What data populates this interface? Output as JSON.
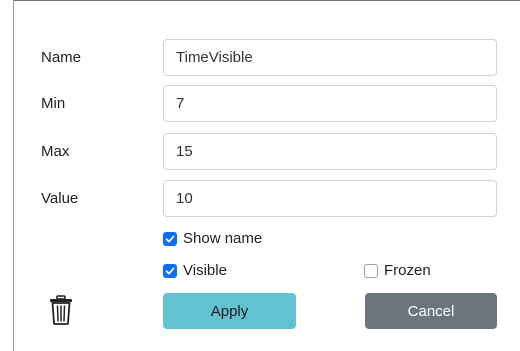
{
  "form": {
    "name": {
      "label": "Name",
      "value": "TimeVisible"
    },
    "min": {
      "label": "Min",
      "value": "7"
    },
    "max": {
      "label": "Max",
      "value": "15"
    },
    "value": {
      "label": "Value",
      "value": "10"
    }
  },
  "options": {
    "show_name": {
      "label": "Show name",
      "checked": true
    },
    "visible": {
      "label": "Visible",
      "checked": true
    },
    "frozen": {
      "label": "Frozen",
      "checked": false
    }
  },
  "actions": {
    "apply_label": "Apply",
    "cancel_label": "Cancel",
    "delete_icon": "trash-icon"
  },
  "colors": {
    "checkbox_checked": "#0d6efd",
    "apply_button": "#62c2d2",
    "cancel_button": "#6c757d"
  }
}
